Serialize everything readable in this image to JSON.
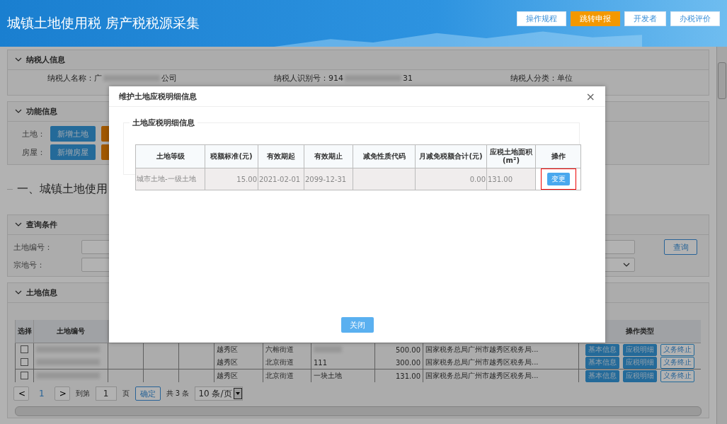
{
  "header": {
    "title": "城镇土地使用税 房产税税源采集",
    "buttons": [
      {
        "label": "操作规程",
        "kind": "plain"
      },
      {
        "label": "跳转申报",
        "kind": "primary"
      },
      {
        "label": "开发者",
        "kind": "plain"
      },
      {
        "label": "办税评价",
        "kind": "plain"
      }
    ]
  },
  "taxpayer_panel": {
    "title": "纳税人信息",
    "fields": [
      {
        "texts": [
          "纳税人名称：广",
          "公司"
        ],
        "redacted": true
      },
      {
        "texts": [
          "纳税人识别号：914",
          "31"
        ],
        "redacted": true
      },
      {
        "texts": [
          "纳税人分类：单位"
        ],
        "redacted": false
      }
    ]
  },
  "function_panel": {
    "title": "功能信息",
    "rows": [
      {
        "label": "土地：",
        "button": "新增土地"
      },
      {
        "label": "房屋：",
        "button": "新增房屋"
      }
    ]
  },
  "section_heading": "一、城镇土地使用",
  "query_panel": {
    "title": "查询条件",
    "fields": [
      {
        "label": "土地编号：",
        "kind": "input"
      },
      {
        "label": "宗地号：",
        "kind": "select"
      }
    ],
    "search_button": "查询"
  },
  "land_panel": {
    "title": "土地信息",
    "columns": [
      "选择",
      "土地编号",
      "",
      "",
      "",
      "",
      "",
      "",
      "",
      "",
      "操作类型"
    ],
    "rows": [
      {
        "checked": false,
        "cells": [
          {
            "redacted": true
          },
          {
            "redacted": false
          },
          {
            "redacted": false
          },
          {
            "redacted": false
          },
          {
            "text": "越秀区",
            "redacted": false
          },
          {
            "text": "六榕街道",
            "redacted": false
          },
          {
            "redacted": true
          },
          {
            "text": "500.00",
            "redacted": false
          },
          {
            "text": "国家税务总局广州市越秀区税务局...",
            "redacted": false
          }
        ],
        "buttons": [
          {
            "label": "基本信息",
            "kind": "filled"
          },
          {
            "label": "应税明细",
            "kind": "filled"
          },
          {
            "label": "义务终止",
            "kind": "outline"
          }
        ]
      },
      {
        "checked": false,
        "cells": [
          {
            "redacted": true
          },
          {
            "redacted": false
          },
          {
            "redacted": false
          },
          {
            "redacted": false
          },
          {
            "text": "越秀区",
            "redacted": false
          },
          {
            "text": "北京街道",
            "redacted": false
          },
          {
            "text": "111",
            "redacted": false
          },
          {
            "text": "300.00",
            "redacted": false
          },
          {
            "text": "国家税务总局广州市越秀区税务局...",
            "redacted": false
          }
        ],
        "buttons": [
          {
            "label": "基本信息",
            "kind": "filled"
          },
          {
            "label": "应税明细",
            "kind": "filled"
          },
          {
            "label": "义务终止",
            "kind": "outline"
          }
        ]
      },
      {
        "checked": false,
        "cells": [
          {
            "redacted": true
          },
          {
            "redacted": false
          },
          {
            "redacted": false
          },
          {
            "redacted": false
          },
          {
            "text": "越秀区",
            "redacted": false
          },
          {
            "text": "北京街道",
            "redacted": false
          },
          {
            "text": "一块土地",
            "redacted": false
          },
          {
            "text": "131.00",
            "redacted": false
          },
          {
            "text": "国家税务总局广州市越秀区税务局...",
            "redacted": false
          }
        ],
        "buttons": [
          {
            "label": "基本信息",
            "kind": "filled"
          },
          {
            "label": "应税明细",
            "kind": "filled"
          },
          {
            "label": "义务终止",
            "kind": "outline"
          }
        ]
      }
    ],
    "pagination": {
      "prev": "<",
      "page": "1",
      "next": ">",
      "goto_label": "到第",
      "goto_value": "1",
      "page_unit": "页",
      "confirm": "确定",
      "total": "共 3 条",
      "page_size": "10 条/页"
    }
  },
  "dialog": {
    "title": "维护土地应税明细信息",
    "close": "×",
    "legend": "土地应税明细信息",
    "columns": [
      "土地等级",
      "税额标准(元)",
      "有效期起",
      "有效期止",
      "减免性质代码",
      "月减免税额合计(元)",
      "应税土地面积(m²)",
      "操作"
    ],
    "rows": [
      {
        "cells": [
          "城市土地-一级土地",
          "15.00",
          "2021-02-01",
          "2099-12-31",
          "",
          "0.00",
          "131.00"
        ],
        "action": "变更",
        "highlighted": true
      }
    ],
    "close_button": "关闭"
  }
}
